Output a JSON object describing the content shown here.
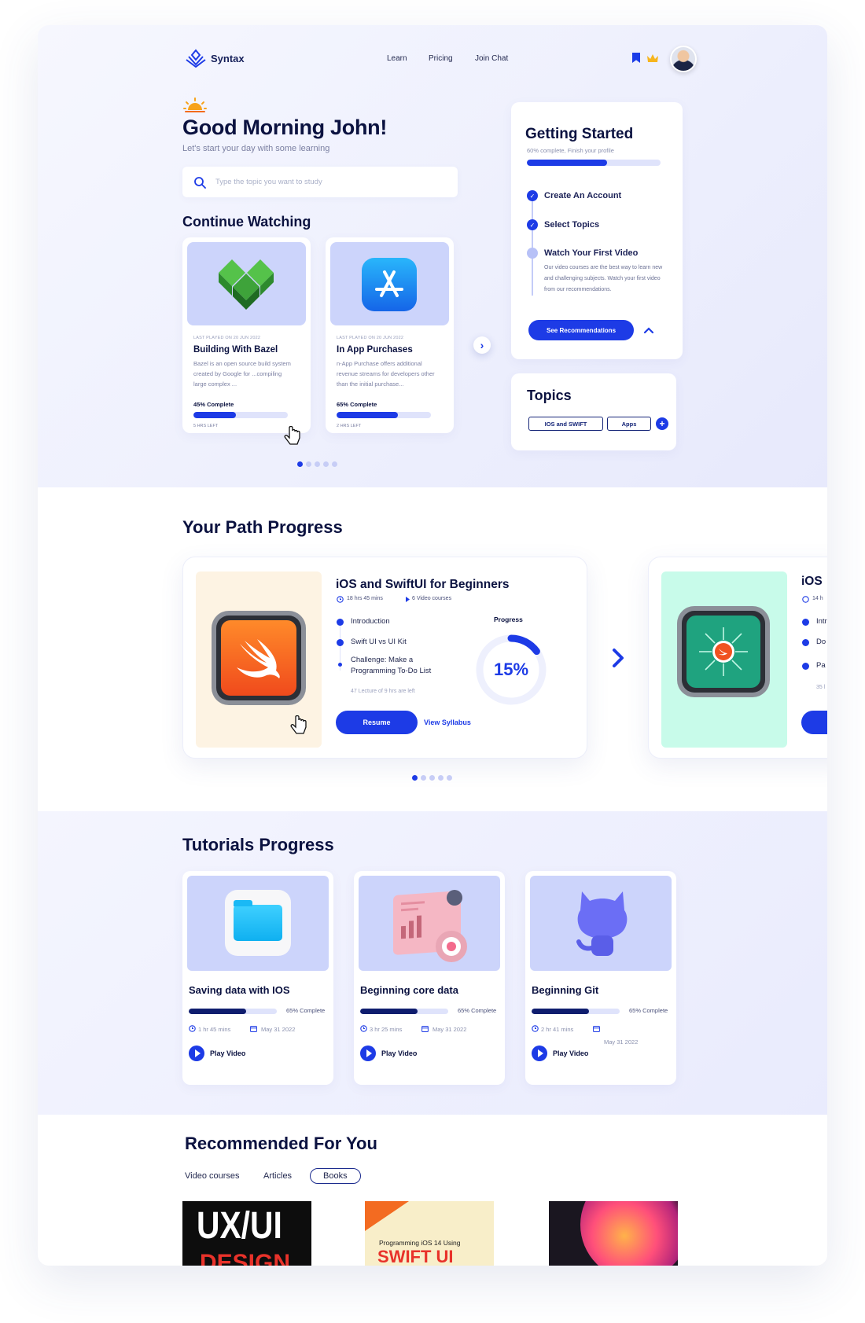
{
  "header": {
    "brand": "Syntax",
    "nav": [
      "Learn",
      "Pricing",
      "Join Chat"
    ]
  },
  "greeting": {
    "title": "Good Morning John!",
    "subtitle": "Let's start your day with some learning"
  },
  "search": {
    "placeholder": "Type the topic you want to study"
  },
  "continue_watching": {
    "title": "Continue Watching",
    "cards": [
      {
        "meta": "LAST PLAYED ON 20 JUN 2022",
        "title": "Building With Bazel",
        "desc": "Bazel is an open source build system created by Google for ...compiling large complex ...",
        "progress_label": "45% Complete",
        "progress": 0.45,
        "time_left": "5 HRS LEFT"
      },
      {
        "meta": "LAST PLAYED ON 20 JUN 2022",
        "title": "In App Purchases",
        "desc": "n-App Purchase offers additional revenue streams for developers other than the initial purchase...",
        "progress_label": "65% Complete",
        "progress": 0.65,
        "time_left": "2 HRS LEFT"
      }
    ]
  },
  "getting_started": {
    "title": "Getting Started",
    "subtitle": "60% complete, Finish your profile",
    "progress": 0.6,
    "steps": [
      {
        "label": "Create An Account",
        "done": true
      },
      {
        "label": "Select Topics",
        "done": true
      },
      {
        "label": "Watch Your First Video",
        "done": false
      }
    ],
    "step_desc": "Our video courses are the best way to learn new and challenging subjects. Watch your first video from our recommendations.",
    "cta": "See Recommendations"
  },
  "topics": {
    "title": "Topics",
    "tags": [
      "IOS and SWIFT",
      "Apps"
    ],
    "add": "+"
  },
  "path_progress": {
    "title": "Your Path Progress",
    "course": {
      "title": "iOS and SwiftUI for Beginners",
      "duration": "18 hrs 45 mins",
      "videos": "6 Video courses",
      "lessons": [
        "Introduction",
        "Swift UI vs UI Kit",
        "Challenge: Make a Programming To-Do List"
      ],
      "lecture_note": "47 Lecture of 9 hrs are left",
      "progress_label": "Progress",
      "progress_value": "15%",
      "progress": 0.15,
      "resume": "Resume",
      "syllabus": "View Syllabus"
    },
    "next_course": {
      "title": "iOS",
      "duration": "14 h",
      "lessons": [
        "Intr",
        "Do",
        "Pa"
      ],
      "lecture_note": "35 l"
    }
  },
  "tutorials": {
    "title": "Tutorials Progress",
    "items": [
      {
        "title": "Saving data with IOS",
        "progress": 0.65,
        "progress_label": "65% Complete",
        "duration": "1 hr 45 mins",
        "date": "May 31 2022",
        "play": "Play Video"
      },
      {
        "title": "Beginning core data",
        "progress": 0.65,
        "progress_label": "65% Complete",
        "duration": "3 hr 25 mins",
        "date": "May 31 2022",
        "play": "Play Video"
      },
      {
        "title": "Beginning Git",
        "progress": 0.65,
        "progress_label": "65% Complete",
        "duration": "2 hr 41 mins",
        "date": "May 31 2022",
        "play": "Play Video"
      }
    ]
  },
  "recommended": {
    "title": "Recommended For You",
    "tabs": [
      "Video courses",
      "Articles",
      "Books"
    ],
    "active_tab": "Books",
    "books": [
      {
        "cover_text": "UX/UI",
        "cover_text2": "DESIGN"
      },
      {
        "cover_text": "Programming iOS 14 Using",
        "cover_text2": "SWIFT UI"
      },
      {
        "cover_text": ""
      }
    ]
  },
  "colors": {
    "accent": "#1d3be6",
    "navy": "#0b1240",
    "hero_bg": "#eef0fd",
    "card_img": "#ccd4fb"
  }
}
